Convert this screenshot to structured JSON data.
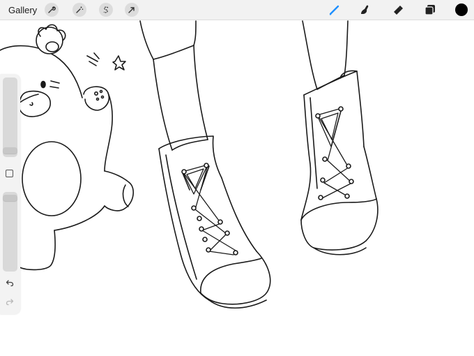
{
  "toolbar": {
    "gallery_label": "Gallery",
    "actions_icon": "wrench-icon",
    "adjustments_icon": "magic-wand-icon",
    "selection_icon": "selection-s-icon",
    "transform_icon": "arrow-cursor-icon",
    "brush_icon": "brush-icon",
    "smudge_icon": "smudge-icon",
    "eraser_icon": "eraser-icon",
    "layers_icon": "layers-icon",
    "active_tool": "brush",
    "accent_color": "#1e90ff",
    "current_color": "#000000"
  },
  "sidebar": {
    "brush_size": 0.95,
    "opacity": 0.04,
    "undo_icon": "undo-icon",
    "redo_icon": "redo-icon"
  }
}
